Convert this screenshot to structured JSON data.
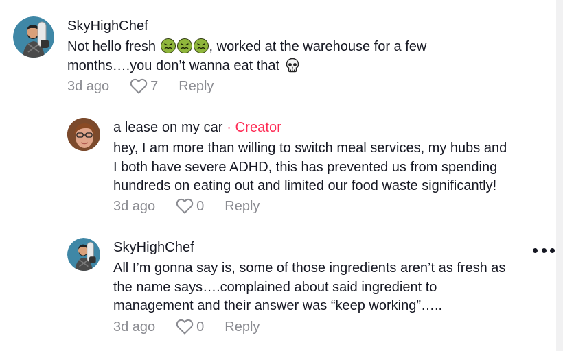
{
  "comments": [
    {
      "username": "SkyHighChef",
      "avatar_icon": "chef-avatar-icon",
      "text_part1": "Not hello fresh ",
      "text_part2": ", worked at the warehouse for a few",
      "text_line2": "months….you don’t wanna eat that ",
      "time": "3d ago",
      "likes": "7",
      "reply_label": "Reply"
    },
    {
      "username": "a lease on my car",
      "separator": " · ",
      "badge": "Creator",
      "avatar_icon": "woman-avatar-icon",
      "text_lines": [
        "hey, I am more than willing to switch meal services, my hubs and",
        "I both have severe ADHD, this has prevented us from spending",
        "hundreds on eating out and limited our food waste significantly!"
      ],
      "time": "3d ago",
      "likes": "0",
      "reply_label": "Reply"
    },
    {
      "username": "SkyHighChef",
      "avatar_icon": "chef-avatar-icon",
      "text_lines": [
        "All I’m gonna say is, some of those ingredients aren’t as fresh as",
        "the name says….complained about said ingredient to",
        "management and their answer was “keep working”….."
      ],
      "time": "3d ago",
      "likes": "0",
      "reply_label": "Reply"
    }
  ],
  "colors": {
    "text": "#161823",
    "meta": "#8a8b91",
    "creator": "#fe2c55",
    "avatar_bg": "#3f87a6"
  }
}
